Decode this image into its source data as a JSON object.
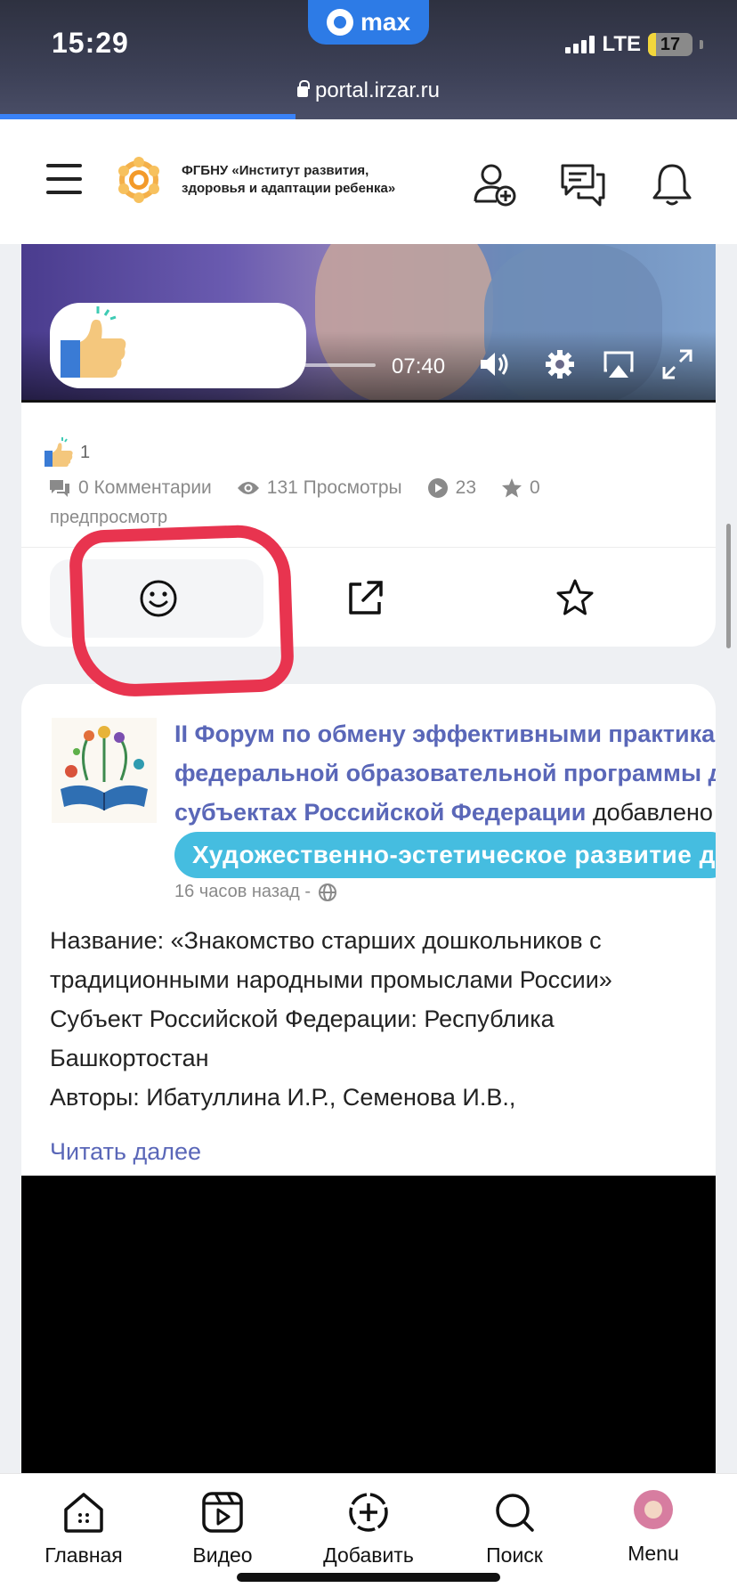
{
  "status_bar": {
    "time": "15:29",
    "app_pill": "max",
    "network": "LTE",
    "battery": "17",
    "battery_fraction": 0.17,
    "url": "portal.irzar.ru"
  },
  "header": {
    "org_name": "ФГБНУ «Институт развития, здоровья и адаптации ребенка»"
  },
  "video1": {
    "duration": "07:40"
  },
  "post1": {
    "likes": "1",
    "comments": "0 Комментарии",
    "views": "131 Просмотры",
    "plays": "23",
    "stars": "0",
    "preview_label": "предпросмотр"
  },
  "post2": {
    "title_line1": "II Форум по обмену эффективными практиками",
    "title_line2": "федеральной образовательной программы д",
    "title_line3": "субъектах Российской Федерации",
    "added": "добавлено",
    "tag": "Художественно-эстетическое развитие д",
    "time_ago": "16 часов назад -",
    "body_lines": [
      "Название: «Знакомство старших дошкольников с",
      "традиционными народными промыслами России»",
      "Субъект Российской Федерации: Республика",
      "Башкортостан",
      "Авторы: Ибатуллина И.Р., Семенова И.В.,"
    ],
    "read_more": "Читать далее"
  },
  "tabbar": {
    "home": "Главная",
    "video": "Видео",
    "add": "Добавить",
    "search": "Поиск",
    "menu": "Menu"
  },
  "colors": {
    "accent": "#5a67b8",
    "tag": "#45bde0",
    "annotation": "#e8344f"
  }
}
